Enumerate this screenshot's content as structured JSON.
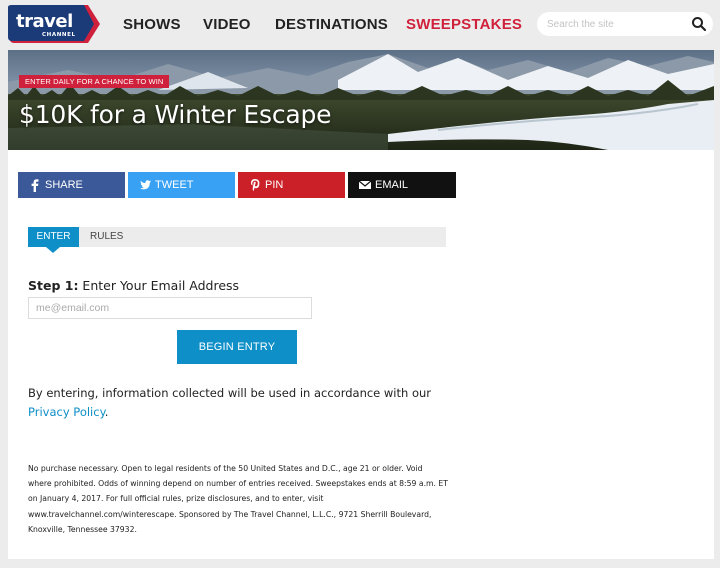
{
  "header": {
    "logo": {
      "word": "travel",
      "sub": "CHANNEL"
    },
    "nav": [
      {
        "label": "SHOWS"
      },
      {
        "label": "VIDEO"
      },
      {
        "label": "DESTINATIONS"
      },
      {
        "label": "SWEEPSTAKES",
        "active": true
      }
    ],
    "search": {
      "placeholder": "Search the site",
      "icon": "magnifier-icon"
    }
  },
  "hero": {
    "badge": "ENTER DAILY FOR A CHANCE TO WIN",
    "title": "$10K for a Winter Escape"
  },
  "share": {
    "facebook": {
      "label": "SHARE",
      "icon": "facebook-icon",
      "color": "#3b5998"
    },
    "twitter": {
      "label": "TWEET",
      "icon": "twitter-icon",
      "color": "#38a1f3"
    },
    "pinterest": {
      "label": "PIN",
      "icon": "pinterest-icon",
      "color": "#cb2027"
    },
    "email": {
      "label": "EMAIL",
      "icon": "envelope-icon",
      "color": "#111111"
    }
  },
  "tabs": [
    {
      "label": "ENTER",
      "active": true
    },
    {
      "label": "RULES",
      "active": false
    }
  ],
  "form": {
    "step_num": "Step 1:",
    "step_label": " Enter Your Email Address",
    "email_placeholder": "me@email.com",
    "email_value": "",
    "submit_label": "BEGIN ENTRY"
  },
  "consent": {
    "text": "By entering, information collected will be used in accordance with our ",
    "link": "Privacy Policy",
    "end": "."
  },
  "fine_print": "No purchase necessary. Open to legal residents of the 50 United States and D.C., age 21 or older. Void where prohibited. Odds of winning depend on number of entries received. Sweepstakes ends at 8:59 a.m. ET on January 4, 2017. For full official rules, prize disclosures, and to enter, visit www.travelchannel.com/winterescape. Sponsored by The Travel Channel, L.L.C., 9721 Sherrill Boulevard, Knoxville, Tennessee 37932.",
  "colors": {
    "brand_red": "#d0213c",
    "accent_blue": "#0e8fc8",
    "logo_navy": "#1b3a78"
  }
}
